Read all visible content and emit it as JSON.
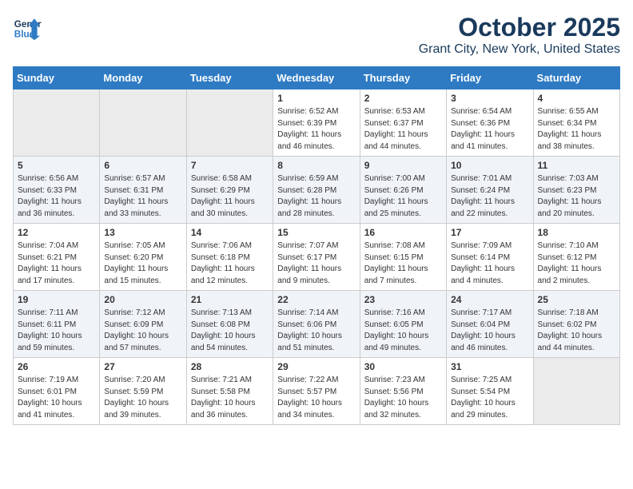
{
  "header": {
    "logo_line1": "General",
    "logo_line2": "Blue",
    "month": "October 2025",
    "location": "Grant City, New York, United States"
  },
  "days_of_week": [
    "Sunday",
    "Monday",
    "Tuesday",
    "Wednesday",
    "Thursday",
    "Friday",
    "Saturday"
  ],
  "weeks": [
    [
      {
        "day": "",
        "empty": true
      },
      {
        "day": "",
        "empty": true
      },
      {
        "day": "",
        "empty": true
      },
      {
        "day": "1",
        "info": "Sunrise: 6:52 AM\nSunset: 6:39 PM\nDaylight: 11 hours\nand 46 minutes."
      },
      {
        "day": "2",
        "info": "Sunrise: 6:53 AM\nSunset: 6:37 PM\nDaylight: 11 hours\nand 44 minutes."
      },
      {
        "day": "3",
        "info": "Sunrise: 6:54 AM\nSunset: 6:36 PM\nDaylight: 11 hours\nand 41 minutes."
      },
      {
        "day": "4",
        "info": "Sunrise: 6:55 AM\nSunset: 6:34 PM\nDaylight: 11 hours\nand 38 minutes."
      }
    ],
    [
      {
        "day": "5",
        "info": "Sunrise: 6:56 AM\nSunset: 6:33 PM\nDaylight: 11 hours\nand 36 minutes."
      },
      {
        "day": "6",
        "info": "Sunrise: 6:57 AM\nSunset: 6:31 PM\nDaylight: 11 hours\nand 33 minutes."
      },
      {
        "day": "7",
        "info": "Sunrise: 6:58 AM\nSunset: 6:29 PM\nDaylight: 11 hours\nand 30 minutes."
      },
      {
        "day": "8",
        "info": "Sunrise: 6:59 AM\nSunset: 6:28 PM\nDaylight: 11 hours\nand 28 minutes."
      },
      {
        "day": "9",
        "info": "Sunrise: 7:00 AM\nSunset: 6:26 PM\nDaylight: 11 hours\nand 25 minutes."
      },
      {
        "day": "10",
        "info": "Sunrise: 7:01 AM\nSunset: 6:24 PM\nDaylight: 11 hours\nand 22 minutes."
      },
      {
        "day": "11",
        "info": "Sunrise: 7:03 AM\nSunset: 6:23 PM\nDaylight: 11 hours\nand 20 minutes."
      }
    ],
    [
      {
        "day": "12",
        "info": "Sunrise: 7:04 AM\nSunset: 6:21 PM\nDaylight: 11 hours\nand 17 minutes."
      },
      {
        "day": "13",
        "info": "Sunrise: 7:05 AM\nSunset: 6:20 PM\nDaylight: 11 hours\nand 15 minutes."
      },
      {
        "day": "14",
        "info": "Sunrise: 7:06 AM\nSunset: 6:18 PM\nDaylight: 11 hours\nand 12 minutes."
      },
      {
        "day": "15",
        "info": "Sunrise: 7:07 AM\nSunset: 6:17 PM\nDaylight: 11 hours\nand 9 minutes."
      },
      {
        "day": "16",
        "info": "Sunrise: 7:08 AM\nSunset: 6:15 PM\nDaylight: 11 hours\nand 7 minutes."
      },
      {
        "day": "17",
        "info": "Sunrise: 7:09 AM\nSunset: 6:14 PM\nDaylight: 11 hours\nand 4 minutes."
      },
      {
        "day": "18",
        "info": "Sunrise: 7:10 AM\nSunset: 6:12 PM\nDaylight: 11 hours\nand 2 minutes."
      }
    ],
    [
      {
        "day": "19",
        "info": "Sunrise: 7:11 AM\nSunset: 6:11 PM\nDaylight: 10 hours\nand 59 minutes."
      },
      {
        "day": "20",
        "info": "Sunrise: 7:12 AM\nSunset: 6:09 PM\nDaylight: 10 hours\nand 57 minutes."
      },
      {
        "day": "21",
        "info": "Sunrise: 7:13 AM\nSunset: 6:08 PM\nDaylight: 10 hours\nand 54 minutes."
      },
      {
        "day": "22",
        "info": "Sunrise: 7:14 AM\nSunset: 6:06 PM\nDaylight: 10 hours\nand 51 minutes."
      },
      {
        "day": "23",
        "info": "Sunrise: 7:16 AM\nSunset: 6:05 PM\nDaylight: 10 hours\nand 49 minutes."
      },
      {
        "day": "24",
        "info": "Sunrise: 7:17 AM\nSunset: 6:04 PM\nDaylight: 10 hours\nand 46 minutes."
      },
      {
        "day": "25",
        "info": "Sunrise: 7:18 AM\nSunset: 6:02 PM\nDaylight: 10 hours\nand 44 minutes."
      }
    ],
    [
      {
        "day": "26",
        "info": "Sunrise: 7:19 AM\nSunset: 6:01 PM\nDaylight: 10 hours\nand 41 minutes."
      },
      {
        "day": "27",
        "info": "Sunrise: 7:20 AM\nSunset: 5:59 PM\nDaylight: 10 hours\nand 39 minutes."
      },
      {
        "day": "28",
        "info": "Sunrise: 7:21 AM\nSunset: 5:58 PM\nDaylight: 10 hours\nand 36 minutes."
      },
      {
        "day": "29",
        "info": "Sunrise: 7:22 AM\nSunset: 5:57 PM\nDaylight: 10 hours\nand 34 minutes."
      },
      {
        "day": "30",
        "info": "Sunrise: 7:23 AM\nSunset: 5:56 PM\nDaylight: 10 hours\nand 32 minutes."
      },
      {
        "day": "31",
        "info": "Sunrise: 7:25 AM\nSunset: 5:54 PM\nDaylight: 10 hours\nand 29 minutes."
      },
      {
        "day": "",
        "empty": true
      }
    ]
  ]
}
